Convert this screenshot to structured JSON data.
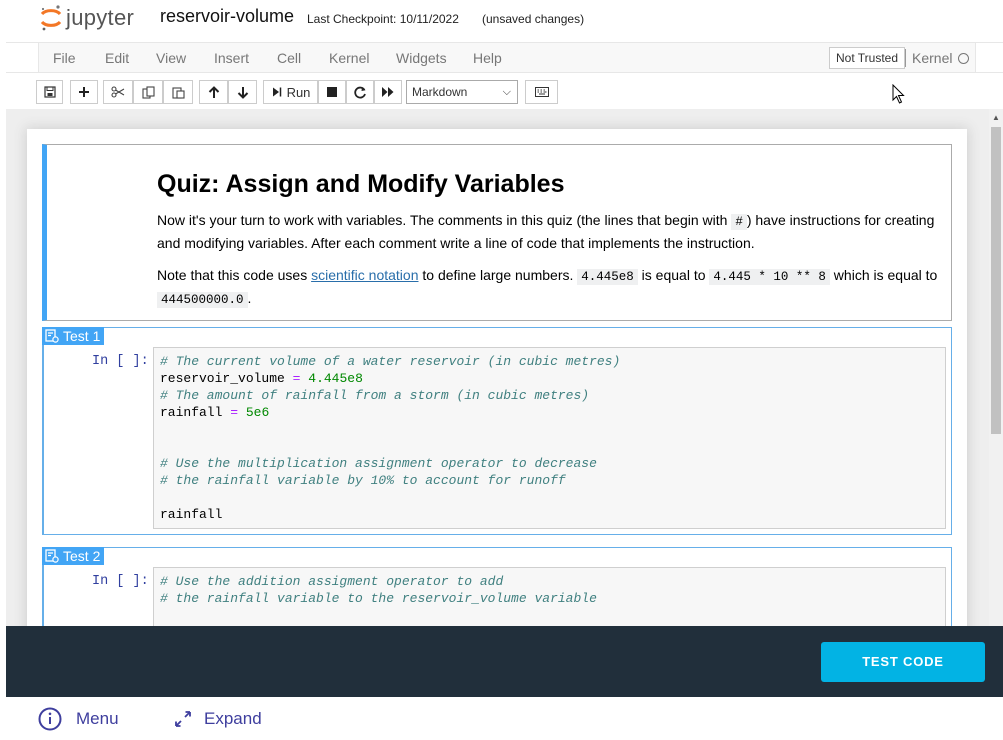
{
  "header": {
    "logo_text": "jupyter",
    "notebook_name": "reservoir-volume",
    "checkpoint": "Last Checkpoint: 10/11/2022",
    "unsaved": "(unsaved changes)"
  },
  "menu": {
    "items": [
      "File",
      "Edit",
      "View",
      "Insert",
      "Cell",
      "Kernel",
      "Widgets",
      "Help"
    ],
    "trust_status": "Not Trusted",
    "kernel_label": "Kernel"
  },
  "toolbar": {
    "run_label": "Run",
    "cell_type": "Markdown",
    "icons": [
      "save-icon",
      "plus-icon",
      "cut-icon",
      "copy-icon",
      "paste-icon",
      "arrow-up-icon",
      "arrow-down-icon",
      "run-icon",
      "stop-icon",
      "restart-icon",
      "fast-forward-icon",
      "keyboard-icon"
    ]
  },
  "markdown_cell": {
    "title": "Quiz: Assign and Modify Variables",
    "p1_before": "Now it's your turn to work with variables. The comments in this quiz (the lines that begin with ",
    "p1_code": "#",
    "p1_after": ") have instructions for creating and modifying variables. After each comment write a line of code that implements the instruction.",
    "p2_before": "Note that this code uses ",
    "p2_link": "scientific notation",
    "p2_mid1": " to define large numbers. ",
    "p2_code1": "4.445e8",
    "p2_mid2": " is equal to ",
    "p2_code2": "4.445 * 10 ** 8",
    "p2_mid3": " which is equal to ",
    "p2_code3": "444500000.0",
    "p2_end": "."
  },
  "cells": [
    {
      "label": "Test 1",
      "prompt": "In [ ]:",
      "lines": [
        "# The current volume of a water reservoir (in cubic metres)",
        "reservoir_volume",
        "=",
        "4.445e8",
        "# The amount of rainfall from a storm (in cubic metres)",
        "rainfall",
        "=",
        "5e6",
        "# Use the multiplication assignment operator to decrease",
        "# the rainfall variable by 10% to account for runoff",
        "rainfall"
      ]
    },
    {
      "label": "Test 2",
      "prompt": "In [ ]:",
      "lines": [
        "# Use the addition assigment operator to add",
        "# the rainfall variable to the reservoir_volume variable"
      ]
    }
  ],
  "footer": {
    "test_code": "TEST CODE",
    "menu": "Menu",
    "expand": "Expand"
  },
  "colors": {
    "accent_blue": "#42a5f5",
    "test_button": "#02b3e4",
    "bottom_bar": "#212f3b",
    "nav_text": "#3e3e9e"
  }
}
